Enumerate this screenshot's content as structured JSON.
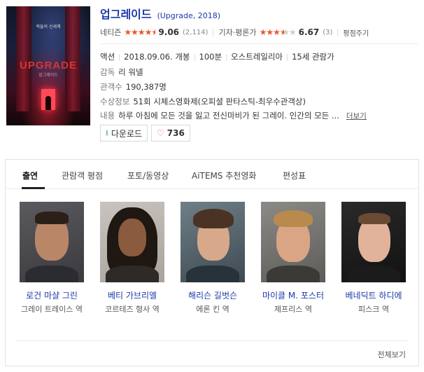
{
  "movie": {
    "poster_alt": "UPGRADE poster",
    "poster_title": "UPGRADE",
    "poster_subtitle": "업그레이드",
    "poster_tag": "적들의 신세계",
    "title": "업그레이드",
    "title_sub": "(Upgrade, 2018)"
  },
  "ratings": {
    "netizen_label": "네티즌",
    "netizen_score": "9.06",
    "netizen_count": "(2,114)",
    "netizen_stars": 4.5,
    "critic_label": "기자·평론가",
    "critic_score": "6.67",
    "critic_count": "(3)",
    "critic_stars": 3.5,
    "rate_label": "평점주기"
  },
  "details": {
    "genre": "액션",
    "release": "2018.09.06. 개봉",
    "runtime": "100분",
    "country": "오스트레일리아",
    "age": "15세 관람가",
    "director_label": "감독",
    "director": "리 워넬",
    "audience_label": "관객수",
    "audience": "190,387명",
    "award_label": "수상정보",
    "award": "51회 시체스영화제(오피셜 판타스틱-최우수관객상)",
    "plot_label": "내용",
    "plot": "하루 아침에 모든 것을 잃고 전신마비가 된 그레이. 인간의 모든 ...",
    "more_label": "더보기"
  },
  "actions": {
    "download_label": "다운로드",
    "like_count": "736"
  },
  "tabs": [
    {
      "label": "출연",
      "active": true
    },
    {
      "label": "관람객 평점"
    },
    {
      "label": "포토/동영상"
    },
    {
      "label": "AiTEMS 추천영화"
    },
    {
      "label": "편성표"
    }
  ],
  "cast": [
    {
      "name": "로건 마샬 그린",
      "role": "그레이 트레이스 역"
    },
    {
      "name": "베티 가브리엘",
      "role": "코르테즈 형사 역"
    },
    {
      "name": "해리슨 길벗슨",
      "role": "에론 킨 역"
    },
    {
      "name": "마이클 M. 포스터",
      "role": "제프리스 역"
    },
    {
      "name": "베네딕트 하디에",
      "role": "피스크 역"
    }
  ],
  "view_all_label": "전체보기",
  "colors": {
    "link": "#1b39a8",
    "star": "#f0552d",
    "download": "#2fb14a",
    "heart": "#e0435e"
  }
}
